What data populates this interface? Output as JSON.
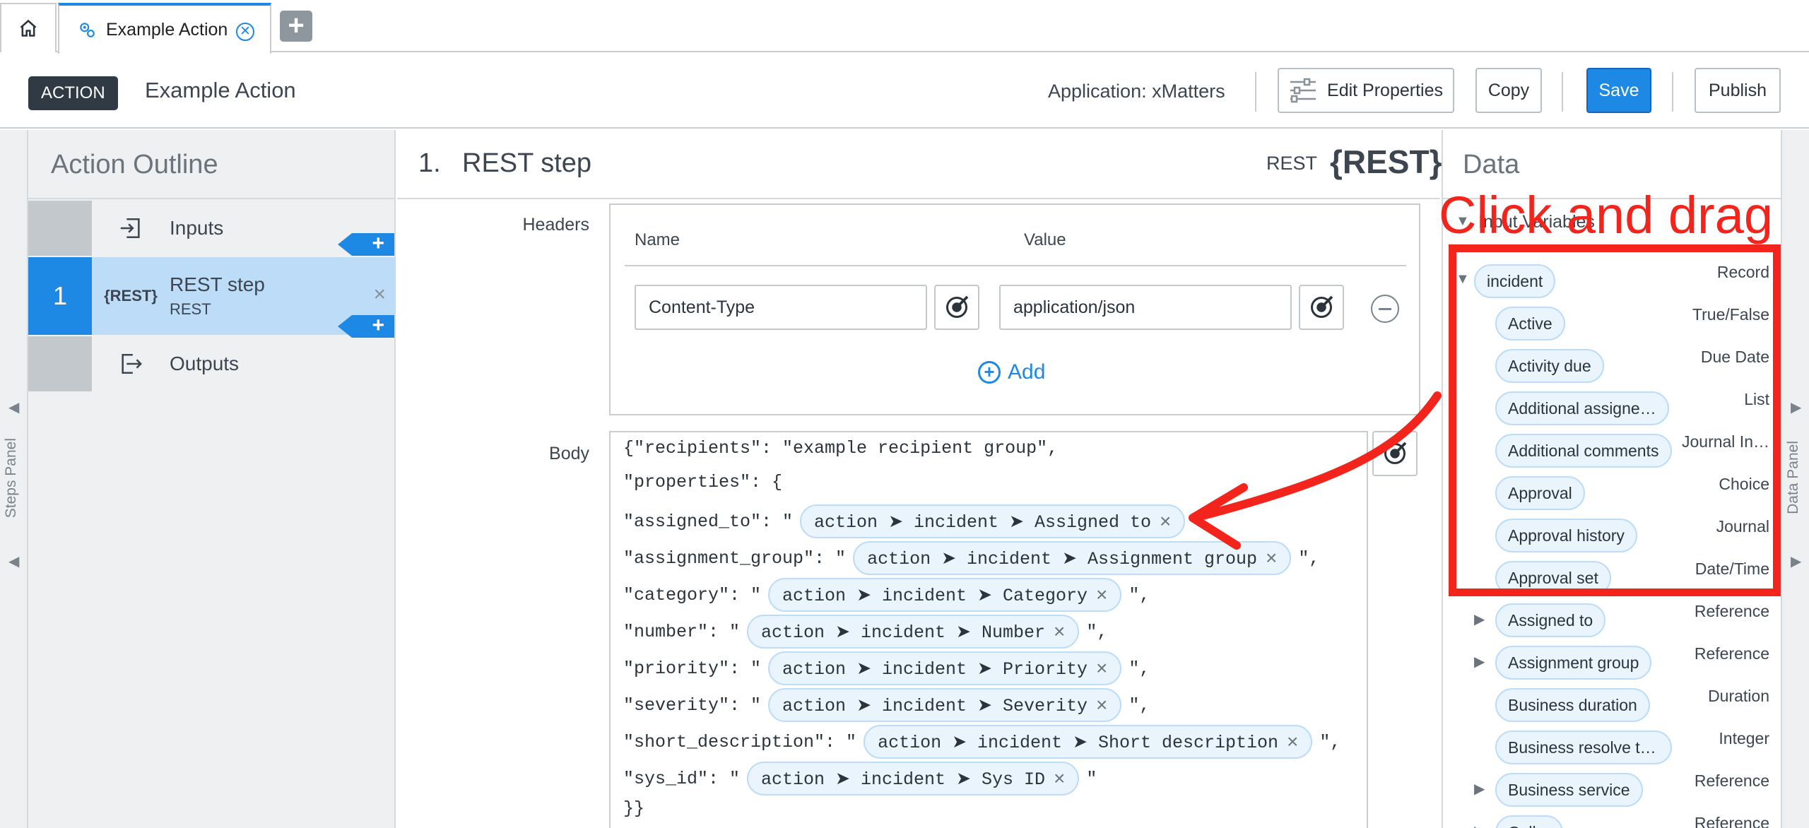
{
  "tabs": {
    "home_icon": "home-icon",
    "active_tab_label": "Example Action",
    "add_tab_symbol": "+"
  },
  "header": {
    "badge": "ACTION",
    "title": "Example Action",
    "application": "Application: xMatters",
    "edit_properties": "Edit Properties",
    "copy": "Copy",
    "save": "Save",
    "publish": "Publish"
  },
  "steps_panel": {
    "label": "Steps Panel"
  },
  "outline": {
    "title": "Action Outline",
    "inputs": "Inputs",
    "step_number": "1",
    "step_icon_text": "{REST}",
    "step_name": "REST step",
    "step_type": "REST",
    "outputs": "Outputs",
    "plus": "+",
    "remove": "×"
  },
  "step": {
    "number": "1.",
    "title": "REST step",
    "type_label": "REST",
    "logo_text": "{REST}",
    "headers_label": "Headers",
    "name_col": "Name",
    "value_col": "Value",
    "header_name": "Content-Type",
    "header_value": "application/json",
    "add_label": "Add",
    "body_label": "Body",
    "body_lines": [
      {
        "pre": "{\"recipients\": \"example recipient group\",",
        "pill": "",
        "post": ""
      },
      {
        "pre": "\"properties\": {",
        "pill": "",
        "post": ""
      },
      {
        "pre": "\"assigned_to\": \"",
        "pill": "action ➤ incident ➤ Assigned to",
        "post": "\","
      },
      {
        "pre": "\"assignment_group\": \"",
        "pill": "action ➤ incident ➤ Assignment group",
        "post": "\","
      },
      {
        "pre": "\"category\": \"",
        "pill": "action ➤ incident ➤ Category",
        "post": "\","
      },
      {
        "pre": "\"number\": \"",
        "pill": "action ➤ incident ➤ Number",
        "post": "\","
      },
      {
        "pre": "\"priority\": \"",
        "pill": "action ➤ incident ➤ Priority",
        "post": "\","
      },
      {
        "pre": "\"severity\": \"",
        "pill": "action ➤ incident ➤ Severity",
        "post": "\","
      },
      {
        "pre": "\"short_description\": \"",
        "pill": "action ➤ incident ➤ Short description",
        "post": "\","
      },
      {
        "pre": "\"sys_id\": \"",
        "pill": "action ➤ incident ➤ Sys ID",
        "post": "\""
      },
      {
        "pre": "}}",
        "pill": "",
        "post": ""
      }
    ],
    "pill_remove": "×"
  },
  "data_panel": {
    "title": "Data",
    "side_label": "Data Panel",
    "input_variables": "Input Variables",
    "items": [
      {
        "name": "incident",
        "type": "Record",
        "level": 0,
        "expander": "▼"
      },
      {
        "name": "Active",
        "type": "True/False",
        "level": 1,
        "expander": ""
      },
      {
        "name": "Activity due",
        "type": "Due Date",
        "level": 1,
        "expander": ""
      },
      {
        "name": "Additional assigne…",
        "type": "List",
        "level": 1,
        "expander": ""
      },
      {
        "name": "Additional comments",
        "type": "Journal In…",
        "level": 1,
        "expander": ""
      },
      {
        "name": "Approval",
        "type": "Choice",
        "level": 1,
        "expander": ""
      },
      {
        "name": "Approval history",
        "type": "Journal",
        "level": 1,
        "expander": ""
      },
      {
        "name": "Approval set",
        "type": "Date/Time",
        "level": 1,
        "expander": ""
      },
      {
        "name": "Assigned to",
        "type": "Reference",
        "level": 1,
        "expander": "▶"
      },
      {
        "name": "Assignment group",
        "type": "Reference",
        "level": 1,
        "expander": "▶"
      },
      {
        "name": "Business duration",
        "type": "Duration",
        "level": 1,
        "expander": ""
      },
      {
        "name": "Business resolve time",
        "type": "Integer",
        "level": 1,
        "expander": ""
      },
      {
        "name": "Business service",
        "type": "Reference",
        "level": 1,
        "expander": "▶"
      },
      {
        "name": "Caller",
        "type": "Reference",
        "level": 1,
        "expander": "▶"
      }
    ]
  },
  "annotation": {
    "text": "Click and drag",
    "color": "#f2241c"
  },
  "colors": {
    "accent": "#1e88e5",
    "pill_bg": "#eaf4fd",
    "panel_bg": "#eef0f2"
  }
}
